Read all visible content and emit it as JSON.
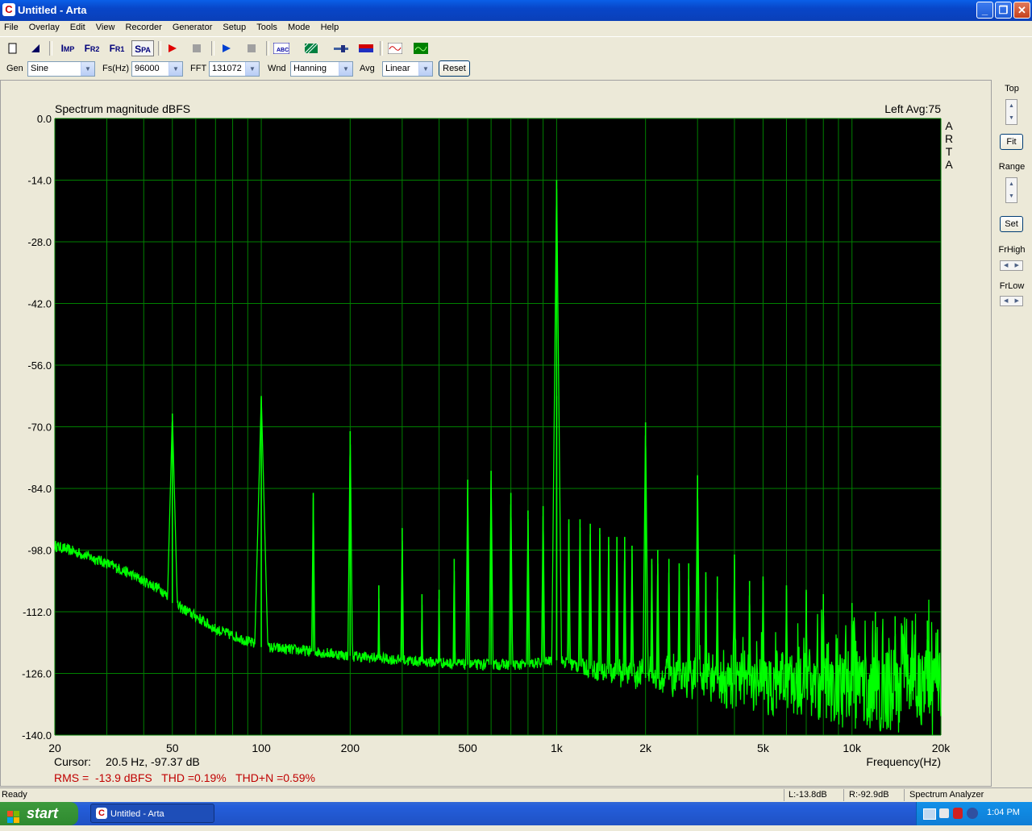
{
  "window": {
    "title": "Untitled - Arta",
    "app_icon": "arta-app-icon"
  },
  "menu": [
    "File",
    "Overlay",
    "Edit",
    "View",
    "Recorder",
    "Generator",
    "Setup",
    "Tools",
    "Mode",
    "Help"
  ],
  "toolbar": {
    "buttons": [
      {
        "name": "new-file-icon",
        "label": ""
      },
      {
        "name": "open-file-icon",
        "label": ""
      },
      {
        "name": "imp-mode-button",
        "label": "Imp"
      },
      {
        "name": "fr2-mode-button",
        "label": "Fr2"
      },
      {
        "name": "fr1-mode-button",
        "label": "Fr1"
      },
      {
        "name": "spa-mode-button",
        "label": "Spa"
      }
    ]
  },
  "controls": {
    "gen_label": "Gen",
    "gen_value": "Sine",
    "fs_label": "Fs(Hz)",
    "fs_value": "96000",
    "fft_label": "FFT",
    "fft_value": "131072",
    "wnd_label": "Wnd",
    "wnd_value": "Hanning",
    "avg_label": "Avg",
    "avg_value": "Linear",
    "reset_label": "Reset"
  },
  "right_panel": {
    "top": "Top",
    "fit": "Fit",
    "range": "Range",
    "set": "Set",
    "frhigh": "FrHigh",
    "frlow": "FrLow"
  },
  "plot": {
    "title": "Spectrum magnitude dBFS",
    "channel_info": "Left  Avg:75",
    "watermark": [
      "A",
      "R",
      "T",
      "A"
    ],
    "cursor_label": "Cursor:",
    "cursor_value": "20.5 Hz, -97.37 dB",
    "freq_label": "Frequency(Hz)",
    "measurements": "RMS =  -13.9 dBFS   THD =0.19%   THD+N =0.59%"
  },
  "status": {
    "ready": "Ready",
    "l_level": "L:-13.8dB",
    "r_level": "R:-92.9dB",
    "mode": "Spectrum Analyzer"
  },
  "taskbar": {
    "start": "start",
    "task": "Untitled - Arta",
    "clock": "1:04 PM"
  },
  "colors": {
    "trace": "#00ff00",
    "grid": "#008000",
    "plot_bg": "#000000",
    "measure_text": "#c00000"
  },
  "chart_data": {
    "type": "line",
    "title": "Spectrum magnitude dBFS",
    "xlabel": "Frequency(Hz)",
    "ylabel": "",
    "x_scale": "log",
    "xlim": [
      20,
      20000
    ],
    "ylim": [
      -140,
      0
    ],
    "y_ticks": [
      "0.0",
      "-14.0",
      "-28.0",
      "-42.0",
      "-56.0",
      "-70.0",
      "-84.0",
      "-98.0",
      "-112.0",
      "-126.0",
      "-140.0"
    ],
    "x_ticks": [
      {
        "v": 20,
        "label": "20"
      },
      {
        "v": 50,
        "label": "50"
      },
      {
        "v": 100,
        "label": "100"
      },
      {
        "v": 200,
        "label": "200"
      },
      {
        "v": 500,
        "label": "500"
      },
      {
        "v": 1000,
        "label": "1k"
      },
      {
        "v": 2000,
        "label": "2k"
      },
      {
        "v": 5000,
        "label": "5k"
      },
      {
        "v": 10000,
        "label": "10k"
      },
      {
        "v": 20000,
        "label": "20k"
      }
    ],
    "grid": true,
    "noise_floor": [
      [
        20,
        -97
      ],
      [
        25,
        -99
      ],
      [
        30,
        -101
      ],
      [
        35,
        -103
      ],
      [
        40,
        -105
      ],
      [
        46,
        -107
      ],
      [
        50,
        -110
      ],
      [
        60,
        -113
      ],
      [
        70,
        -116
      ],
      [
        85,
        -118
      ],
      [
        100,
        -120
      ],
      [
        150,
        -121
      ],
      [
        200,
        -122
      ],
      [
        300,
        -123
      ],
      [
        500,
        -124
      ],
      [
        800,
        -124
      ],
      [
        1000,
        -123
      ],
      [
        1500,
        -126
      ],
      [
        2000,
        -127
      ],
      [
        3000,
        -128
      ],
      [
        5000,
        -129
      ],
      [
        10000,
        -130
      ],
      [
        20000,
        -130
      ]
    ],
    "peaks": [
      [
        50,
        -67
      ],
      [
        100,
        -63
      ],
      [
        150,
        -85
      ],
      [
        200,
        -71
      ],
      [
        250,
        -106
      ],
      [
        300,
        -93
      ],
      [
        350,
        -108
      ],
      [
        400,
        -107
      ],
      [
        450,
        -100
      ],
      [
        500,
        -82
      ],
      [
        600,
        -80
      ],
      [
        700,
        -85
      ],
      [
        800,
        -89
      ],
      [
        900,
        -88
      ],
      [
        1000,
        -14
      ],
      [
        1000,
        -63
      ],
      [
        1100,
        -91
      ],
      [
        1200,
        -91
      ],
      [
        1300,
        -92
      ],
      [
        1400,
        -93
      ],
      [
        1500,
        -95
      ],
      [
        1600,
        -95
      ],
      [
        1700,
        -95
      ],
      [
        1800,
        -97
      ],
      [
        2000,
        -69
      ],
      [
        2100,
        -100
      ],
      [
        2200,
        -98
      ],
      [
        2400,
        -100
      ],
      [
        2600,
        -101
      ],
      [
        2800,
        -101
      ],
      [
        3000,
        -81
      ],
      [
        3200,
        -103
      ],
      [
        3500,
        -104
      ],
      [
        4000,
        -99
      ],
      [
        4500,
        -105
      ],
      [
        5000,
        -104
      ],
      [
        6000,
        -106
      ],
      [
        7000,
        -107
      ],
      [
        8000,
        -108
      ],
      [
        10000,
        -110
      ],
      [
        12000,
        -112
      ],
      [
        14000,
        -113
      ],
      [
        16000,
        -114
      ],
      [
        18000,
        -114
      ],
      [
        19500,
        -116
      ]
    ]
  }
}
